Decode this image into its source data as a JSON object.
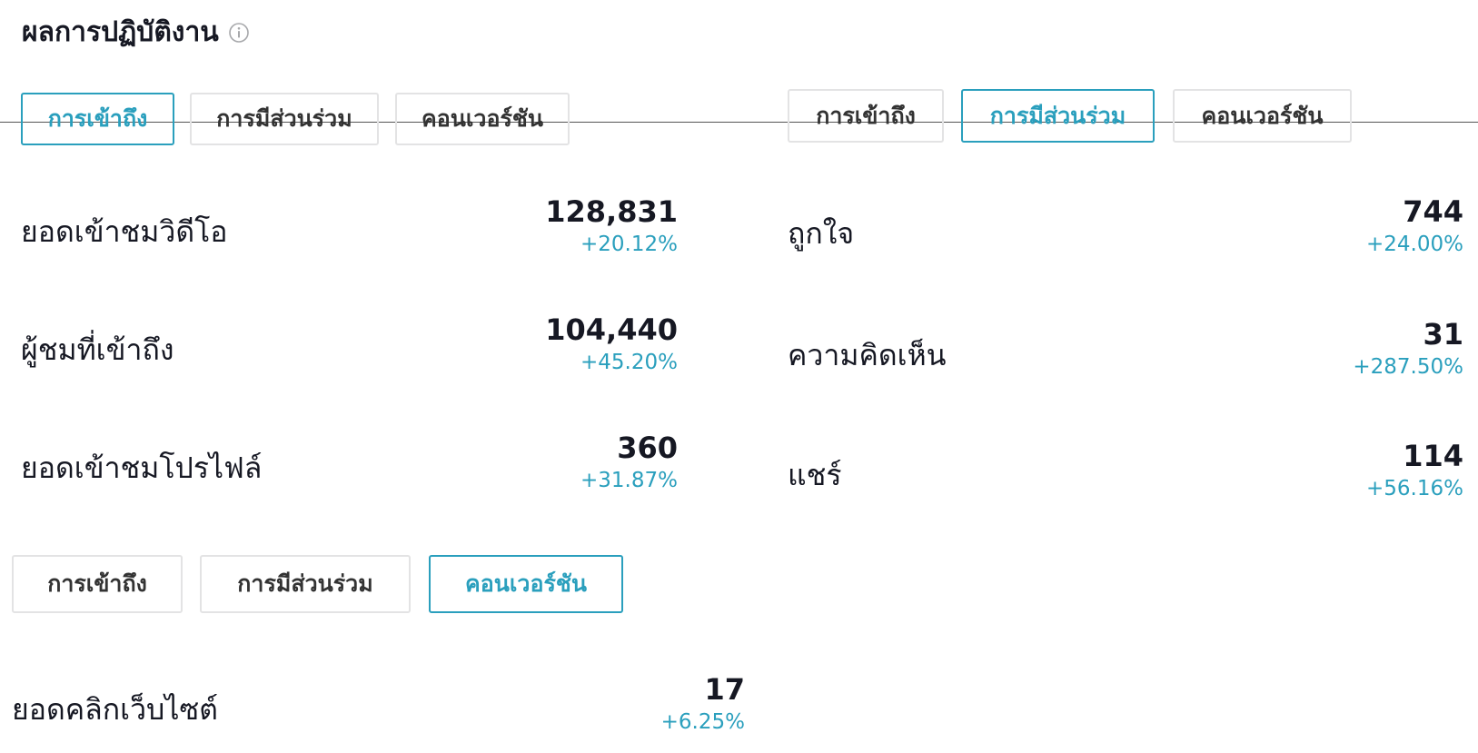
{
  "header": {
    "title": "ผลการปฏิบัติงาน",
    "info_icon": "info-circle-icon"
  },
  "tabs": {
    "reach": "การเข้าถึง",
    "engagement": "การมีส่วนร่วม",
    "conversion": "คอนเวอร์ชัน"
  },
  "panels": {
    "reach": {
      "active_tab": "reach",
      "metrics": [
        {
          "label": "ยอดเข้าชมวิดีโอ",
          "value": "128,831",
          "change": "+20.12%"
        },
        {
          "label": "ผู้ชมที่เข้าถึง",
          "value": "104,440",
          "change": "+45.20%"
        },
        {
          "label": "ยอดเข้าชมโปรไฟล์",
          "value": "360",
          "change": "+31.87%"
        }
      ]
    },
    "engagement": {
      "active_tab": "engagement",
      "metrics": [
        {
          "label": "ถูกใจ",
          "value": "744",
          "change": "+24.00%"
        },
        {
          "label": "ความคิดเห็น",
          "value": "31",
          "change": "+287.50%"
        },
        {
          "label": "แชร์",
          "value": "114",
          "change": "+56.16%"
        }
      ]
    },
    "conversion": {
      "active_tab": "conversion",
      "metrics": [
        {
          "label": "ยอดคลิกเว็บไซต์",
          "value": "17",
          "change": "+6.25%"
        }
      ]
    }
  },
  "colors": {
    "accent": "#2a9fbd",
    "text": "#161823",
    "tab_border": "#e3e3e4"
  }
}
